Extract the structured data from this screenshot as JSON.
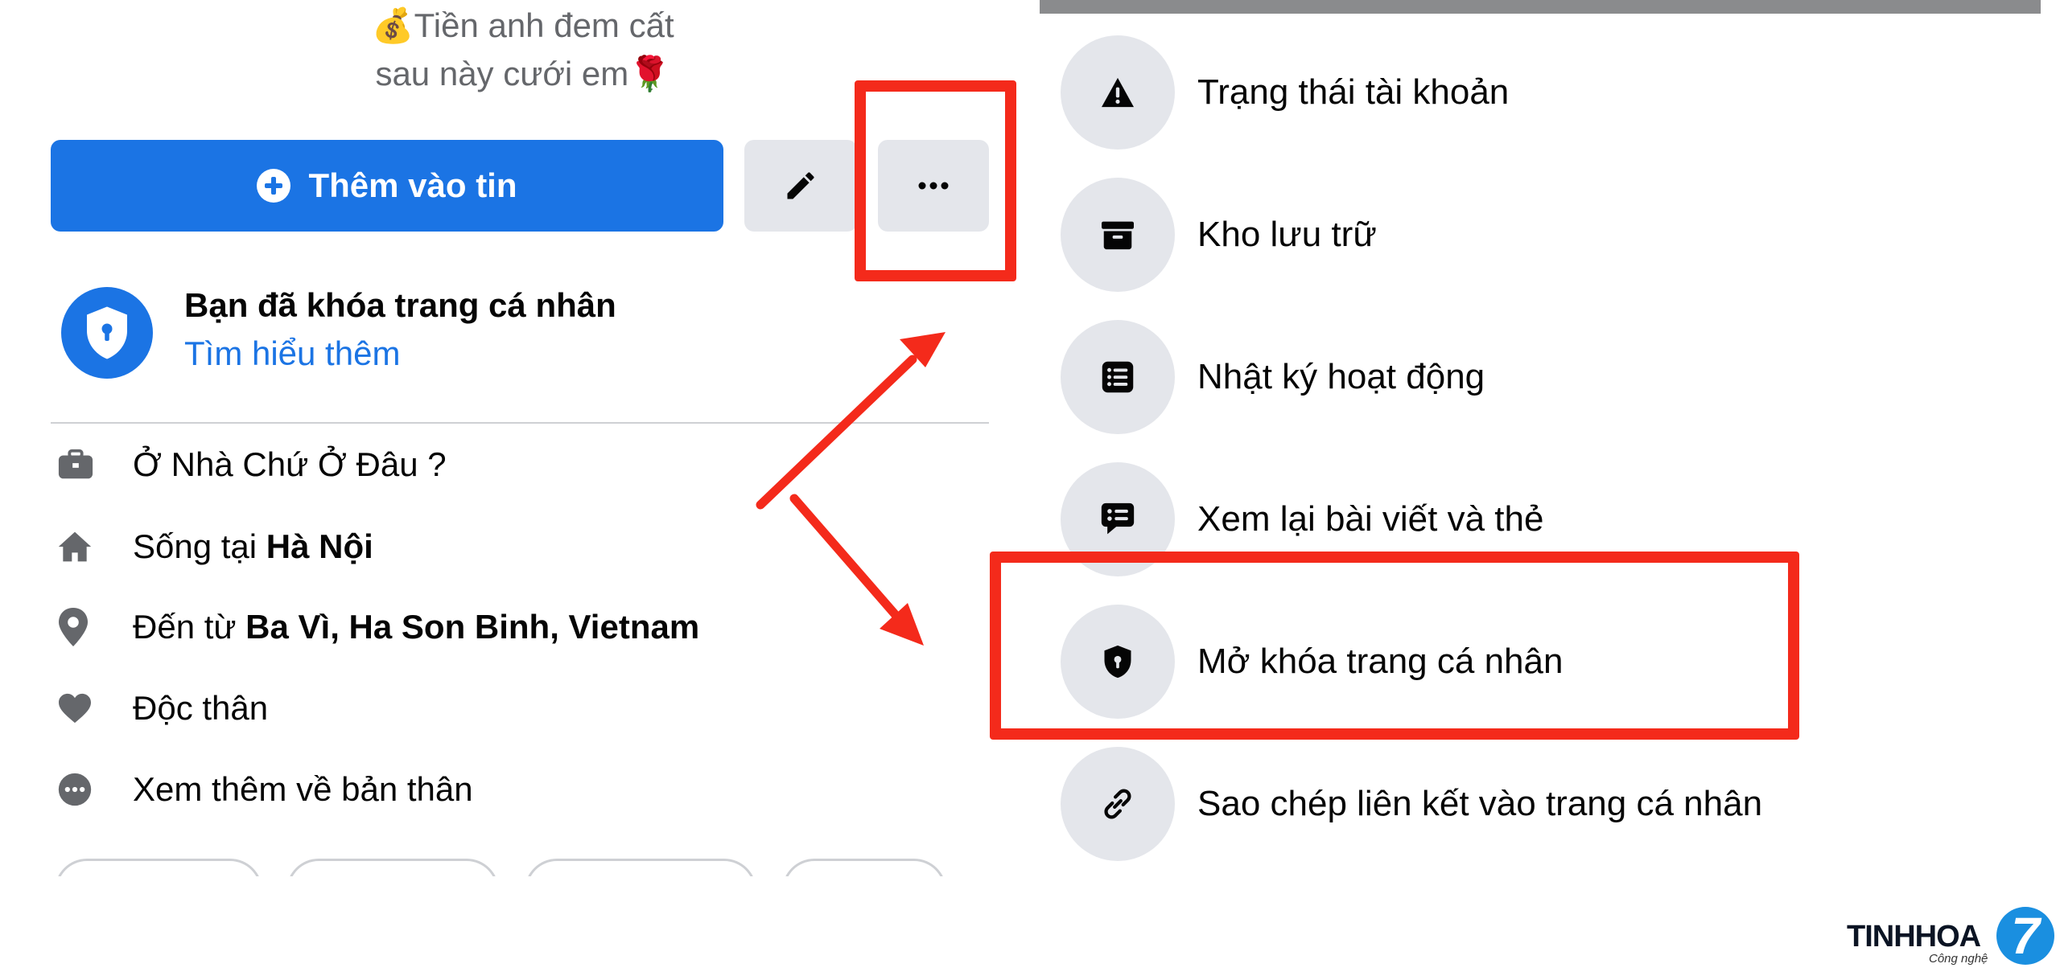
{
  "profile": {
    "bio_line1": "💰Tiền anh đem cất",
    "bio_line2": "sau này cưới em🌹",
    "add_story_label": "Thêm vào tin",
    "locked_title": "Bạn đã khóa trang cá nhân",
    "learn_more_link": "Tìm hiểu thêm",
    "details": [
      {
        "icon": "briefcase-icon",
        "text": "Ở Nhà Chứ Ở Đâu ?"
      },
      {
        "icon": "home-icon",
        "prefix": "Sống tại ",
        "bold": "Hà Nội"
      },
      {
        "icon": "location-pin-icon",
        "prefix": "Đến từ ",
        "bold": "Ba Vì, Ha Son Binh, Vietnam"
      },
      {
        "icon": "heart-icon",
        "text": "Độc thân"
      },
      {
        "icon": "more-circle-icon",
        "text": "Xem thêm về bản thân"
      }
    ]
  },
  "menu": {
    "items": [
      {
        "icon": "warning-icon",
        "label": "Trạng thái tài khoản"
      },
      {
        "icon": "archive-icon",
        "label": "Kho lưu trữ"
      },
      {
        "icon": "activity-log-icon",
        "label": "Nhật ký hoạt động"
      },
      {
        "icon": "review-posts-icon",
        "label": "Xem lại bài viết và thẻ"
      },
      {
        "icon": "unlock-shield-icon",
        "label": "Mở khóa trang cá nhân"
      },
      {
        "icon": "link-icon",
        "label": "Sao chép liên kết vào trang cá nhân"
      }
    ]
  },
  "watermark": {
    "brand": "TINHHOA",
    "badge": "7",
    "tagline": "Công nghệ"
  },
  "colors": {
    "accent_blue": "#1b74e4",
    "annotation_red": "#f42a1b",
    "button_gray": "#e4e6eb"
  }
}
